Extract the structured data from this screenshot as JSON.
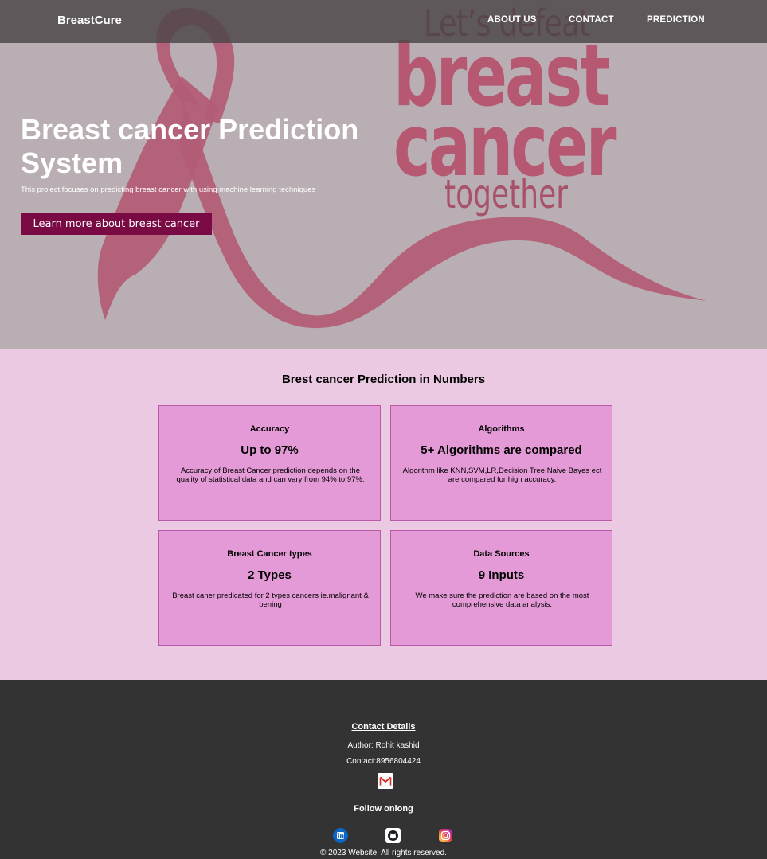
{
  "nav": {
    "brand": "BreastCure",
    "links": [
      "ABOUT US",
      "CONTACT",
      "PREDICTION"
    ]
  },
  "hero": {
    "poster": {
      "line1": "Let’s defeat",
      "line2": "breast",
      "line3": "cancer",
      "line4": "together"
    },
    "title": "Breast cancer Prediction System",
    "subtitle": "This project focuses on predicting breast cancer with using machine learning techniques",
    "button": "Learn more about breast cancer"
  },
  "numbers": {
    "title": "Brest cancer Prediction in Numbers",
    "cards": [
      {
        "label": "Accuracy",
        "value": "Up to 97%",
        "desc": "Accuracy of Breast Cancer prediction depends on the quality of statistical data and can vary from 94% to 97%."
      },
      {
        "label": "Algorithms",
        "value": "5+ Algorithms are compared",
        "desc": "Algorithm like KNN,SVM,LR,Decision Tree,Naive Bayes ect are compared for high accuracy."
      },
      {
        "label": "Breast Cancer types",
        "value": "2 Types",
        "desc": "Breast caner predicated for 2 types cancers ie.malignant & bening"
      },
      {
        "label": "Data Sources",
        "value": "9 Inputs",
        "desc": "We make sure the prediction are based on the most comprehensive data analysis."
      }
    ]
  },
  "footer": {
    "contact_title": "Contact Details",
    "author": "Author: Rohit kashid",
    "contact": "Contact:8956804424",
    "follow": "Follow onlong",
    "copyright": "© 2023 Website. All rights reserved.",
    "icons": [
      "gmail-icon",
      "linkedin-icon",
      "github-icon",
      "instagram-icon"
    ]
  },
  "colors": {
    "hero_bg": "#b9aeb3",
    "ribbon": "#b35b75",
    "button": "#7a0a44",
    "section_bg": "#ecc9e3",
    "card_bg": "#e49ad6",
    "card_border": "#bb5aa9",
    "footer_bg": "#333333"
  }
}
